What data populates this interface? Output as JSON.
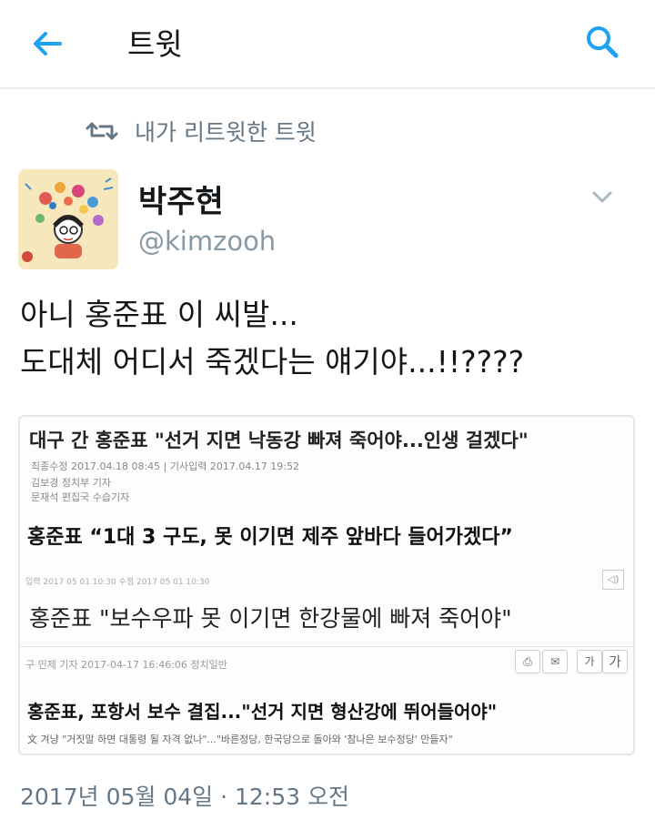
{
  "header": {
    "title": "트윗",
    "colors": {
      "accent": "#1da1f2",
      "divider": "#e6ecf0"
    }
  },
  "retweet": {
    "label": "내가 리트윗한 트윗"
  },
  "author": {
    "name": "박주현",
    "handle": "@kimzooh"
  },
  "tweet": {
    "lines": [
      "아니 홍준표 이 씨발...",
      "도대체 어디서 죽겠다는 얘기야...!!????"
    ],
    "timestamp": "2017년 05월 04일 · 12:53 오전"
  },
  "card": {
    "headline1": "대구 간 홍준표 \"선거 지면 낙동강 빠져 죽어야...인생 걸겠다\"",
    "meta1": "최종수정 2017.04.18 08:45 | 기사입력 2017.04.17 19:52",
    "meta2": "김보경 정치부 기자",
    "meta3": "문재석 편집국 수습기자",
    "headline2": "홍준표 “1대 3 구도, 못 이기면 제주 앞바다 들어가겠다”",
    "meta4": "입력 2017 05 01 10:30    수정 2017 05 01 10:30",
    "headline3": "홍준표 \"보수우파 못 이기면 한강물에 빠져 죽어야\"",
    "byline": "구 민제 기자   2017-04-17 16:46:06   정치일반",
    "font_small": "가",
    "font_large": "가",
    "headline4": "홍준표, 포항서 보수 결집...\"선거 지면 형산강에 뛰어들어야\"",
    "sub4": "文 겨냥 \"거짓말 하면 대통령 될 자격 없나\"...\"바른정당, 한국당으로 돌아와 '참나은 보수정당' 만들자\""
  }
}
